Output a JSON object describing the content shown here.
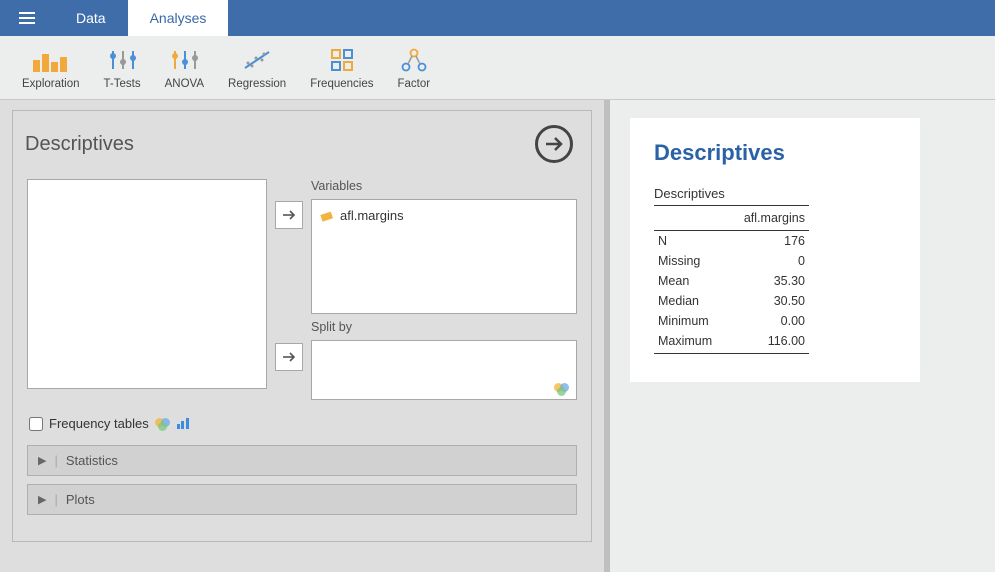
{
  "tabs": {
    "data": "Data",
    "analyses": "Analyses"
  },
  "ribbon": {
    "exploration": "Exploration",
    "ttests": "T-Tests",
    "anova": "ANOVA",
    "regression": "Regression",
    "frequencies": "Frequencies",
    "factor": "Factor"
  },
  "panel": {
    "title": "Descriptives",
    "variables_label": "Variables",
    "splitby_label": "Split by",
    "var_item": "afl.margins",
    "freq_label": "Frequency tables",
    "statistics": "Statistics",
    "plots": "Plots"
  },
  "results": {
    "title": "Descriptives",
    "subtitle": "Descriptives",
    "column": "afl.margins",
    "rows": [
      {
        "label": "N",
        "value": "176"
      },
      {
        "label": "Missing",
        "value": "0"
      },
      {
        "label": "Mean",
        "value": "35.30"
      },
      {
        "label": "Median",
        "value": "30.50"
      },
      {
        "label": "Minimum",
        "value": "0.00"
      },
      {
        "label": "Maximum",
        "value": "116.00"
      }
    ]
  }
}
